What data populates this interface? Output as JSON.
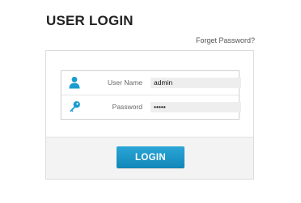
{
  "header": {
    "title": "USER LOGIN",
    "forgot_password": "Forget Password?"
  },
  "form": {
    "username": {
      "label": "User Name",
      "value": "admin",
      "icon": "user-icon"
    },
    "password": {
      "label": "Password",
      "value": "•••••",
      "icon": "key-icon"
    },
    "submit_label": "LOGIN"
  },
  "colors": {
    "accent": "#1a9ccf",
    "title": "#222222"
  }
}
